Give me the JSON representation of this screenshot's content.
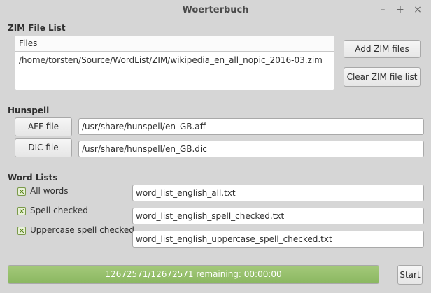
{
  "window": {
    "title": "Woerterbuch",
    "minimize_glyph": "–",
    "maximize_glyph": "+",
    "close_glyph": "×"
  },
  "zim": {
    "section_title": "ZIM File List",
    "column_header": "Files",
    "files": [
      "/home/torsten/Source/WordList/ZIM/wikipedia_en_all_nopic_2016-03.zim"
    ],
    "add_button": "Add ZIM files",
    "clear_button": "Clear ZIM file list"
  },
  "hunspell": {
    "section_title": "Hunspell",
    "aff_button": "AFF file",
    "aff_path": "/usr/share/hunspell/en_GB.aff",
    "dic_button": "DIC file",
    "dic_path": "/usr/share/hunspell/en_GB.dic"
  },
  "wordlists": {
    "section_title": "Word Lists",
    "items": [
      {
        "label": "All words",
        "checked": true,
        "file": "word_list_english_all.txt"
      },
      {
        "label": "Spell checked",
        "checked": true,
        "file": "word_list_english_spell_checked.txt"
      },
      {
        "label": "Uppercase spell checked",
        "checked": true,
        "file": "word_list_english_uppercase_spell_checked.txt"
      }
    ]
  },
  "progress": {
    "text": "12672571/12672571 remaining: 00:00:00",
    "fraction": 1.0,
    "color": "#8ab760"
  },
  "start_button": "Start"
}
